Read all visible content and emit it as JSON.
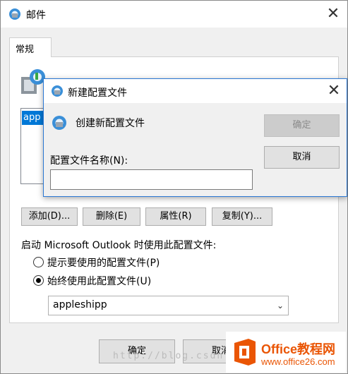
{
  "outer_window": {
    "title": "邮件",
    "close_glyph": "✕",
    "tab_label": "常规",
    "profile_list_item": "app",
    "buttons": {
      "add": "添加(D)...",
      "remove": "删除(E)",
      "properties": "属性(R)",
      "copy": "复制(Y)..."
    },
    "startup_label": "启动 Microsoft Outlook 时使用此配置文件:",
    "radio_prompt": "提示要使用的配置文件(P)",
    "radio_always": "始终使用此配置文件(U)",
    "selected_profile": "appleshipp",
    "ok": "确定",
    "cancel": "取消"
  },
  "dialog": {
    "title": "新建配置文件",
    "heading": "创建新配置文件",
    "name_label": "配置文件名称(N):",
    "name_value": "",
    "ok": "确定",
    "cancel": "取消",
    "close_glyph": "✕"
  },
  "watermark": {
    "url": "http://blog.csdn",
    "brand": "Office教程网",
    "site": "www.office26.com"
  },
  "colors": {
    "accent": "#0078d7",
    "dialog_border": "#2b78d4",
    "watermark_orange": "#ea5504"
  },
  "icons": [
    "mail-icon",
    "close-icon",
    "profile-icon",
    "chevron-down-icon",
    "office-logo-icon"
  ]
}
